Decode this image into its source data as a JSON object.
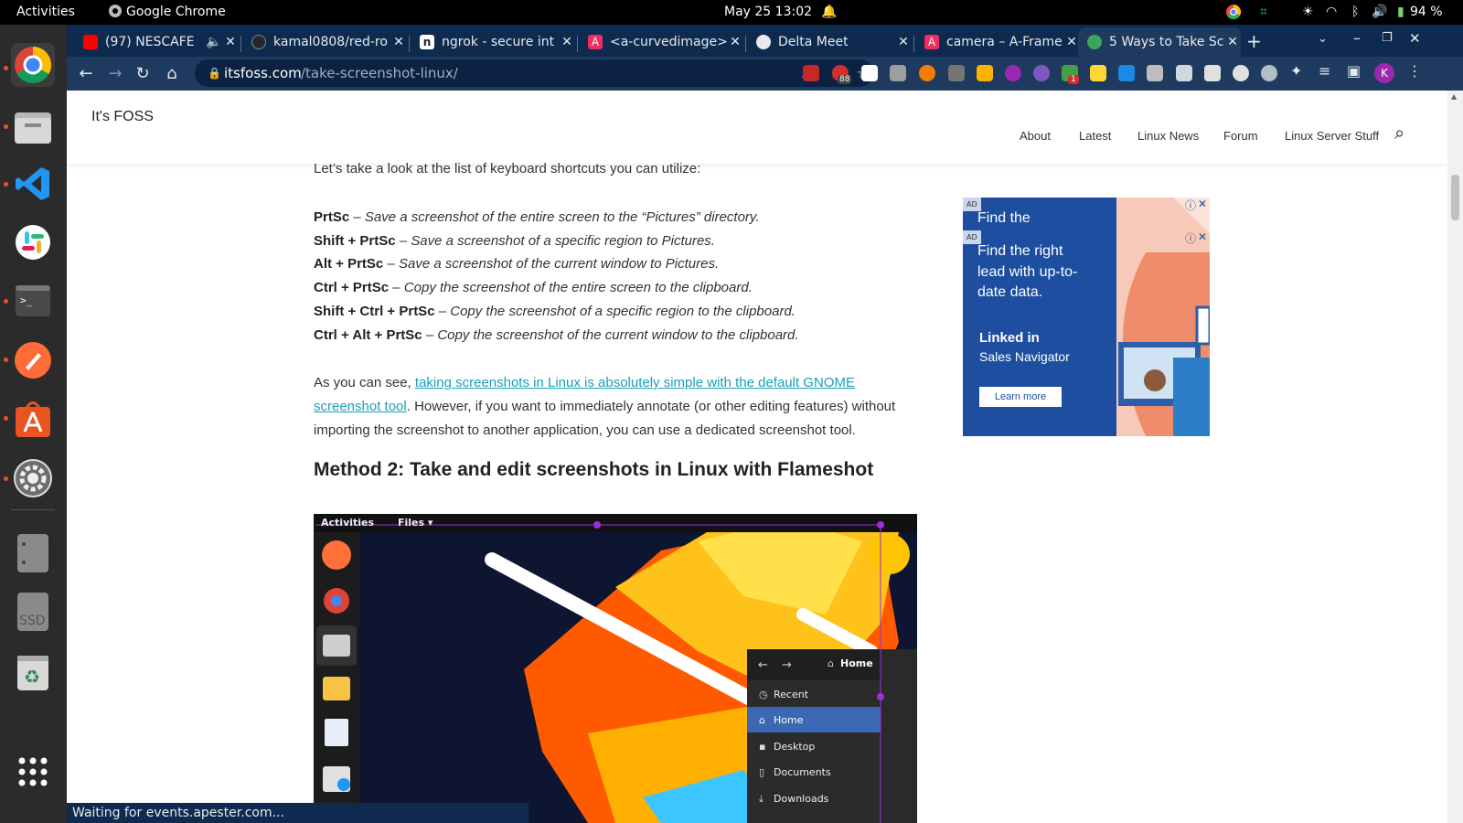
{
  "topbar": {
    "activities": "Activities",
    "app": "Google Chrome",
    "datetime": "May 25  13:02",
    "battery": "94 %"
  },
  "tabs": [
    {
      "title": "(97) NESCAFE",
      "icon": "youtube-icon",
      "color": "#ff0000"
    },
    {
      "title": "kamal0808/red-ro",
      "icon": "github-icon",
      "color": "#24292e"
    },
    {
      "title": "ngrok - secure int",
      "icon": "ngrok-icon",
      "color": "#1f1e37"
    },
    {
      "title": "<a-curvedimage>",
      "icon": "aframe-icon",
      "color": "#ef2d5e"
    },
    {
      "title": "Delta Meet",
      "icon": "globe-icon",
      "color": "#e8eaed"
    },
    {
      "title": "camera – A-Frame",
      "icon": "aframe-icon",
      "color": "#ef2d5e"
    },
    {
      "title": "5 Ways to Take Sc",
      "icon": "itsfoss-icon",
      "color": "#3ba55c"
    }
  ],
  "omnibox": {
    "host": "itsfoss.com",
    "path": "/take-screenshot-linux/"
  },
  "profile_initial": "K",
  "extension_badges": [
    "88",
    "1"
  ],
  "site": {
    "title": "It's FOSS",
    "menu": [
      "About",
      "Latest",
      "Linux News",
      "Forum",
      "Linux Server Stuff"
    ]
  },
  "article": {
    "intro": "Let’s take a look at the list of keyboard shortcuts you can utilize:",
    "shortcuts": [
      {
        "keys": "PrtSc",
        "desc": "Save a screenshot of the entire screen to the “Pictures” directory."
      },
      {
        "keys": "Shift + PrtSc",
        "desc": "Save a screenshot of a specific region to Pictures."
      },
      {
        "keys": "Alt + PrtSc ",
        "desc": "Save a screenshot of the current window to Pictures."
      },
      {
        "keys": "Ctrl + PrtSc",
        "desc": "Copy the screenshot of the entire screen to the clipboard."
      },
      {
        "keys": "Shift + Ctrl + PrtSc",
        "desc": "Copy the screenshot of a specific region to the clipboard."
      },
      {
        "keys": "Ctrl + Alt + PrtSc",
        "desc": "Copy the screenshot of the current window to the clipboard."
      }
    ],
    "para_start": "As you can see, ",
    "link_line1": "taking screenshots in Linux is absolutely simple with the default GNOME",
    "link_line2": "screenshot tool",
    "para_line2_rest": ". However, if you want to immediately annotate (or other editing features) without",
    "para_line3": "importing the screenshot to another application, you can use a dedicated screenshot tool.",
    "heading": "Method 2: Take and edit screenshots in Linux with Flameshot"
  },
  "figure": {
    "topbar_activities": "Activities",
    "topbar_files": "Files ▾",
    "location": "Home",
    "sidebar": [
      "Recent",
      "Home",
      "Desktop",
      "Documents",
      "Downloads"
    ],
    "sidebar_icons": [
      "clock-icon",
      "home-icon",
      "desktop-icon",
      "document-icon",
      "download-icon"
    ]
  },
  "ad": {
    "badge": "AD",
    "peek_text": "Find the",
    "text": "Find the right lead with up-to-date data.",
    "brand": "Linked in",
    "product": "Sales Navigator",
    "cta": "Learn more"
  },
  "status": "Waiting for events.apester.com..."
}
